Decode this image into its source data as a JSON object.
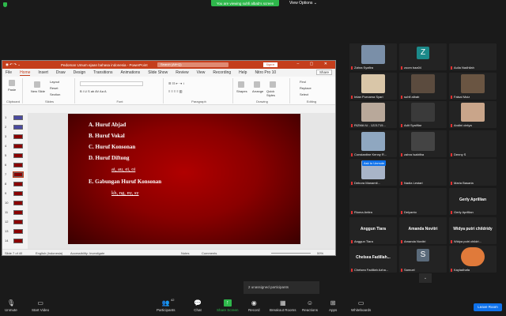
{
  "zoom": {
    "banner": "You are viewing suhfi albab's screen",
    "view_options": "View Options ⌄"
  },
  "ppt": {
    "title": "Pedoman Umum ejaan bahasa indonesia - PowerPoint",
    "search": "Search (Alt+Q)",
    "signin": "Sign in",
    "tabs": [
      "File",
      "Home",
      "Insert",
      "Draw",
      "Design",
      "Transitions",
      "Animations",
      "Slide Show",
      "Review",
      "View",
      "Recording",
      "Help",
      "Nitro Pro 10"
    ],
    "share": "Share",
    "ribbon": {
      "paste": "Paste",
      "clipboard": "Clipboard",
      "new_slide": "New Slide",
      "layout": "Layout",
      "reset": "Reset",
      "section": "Section",
      "slides": "Slides",
      "font": "Font",
      "paragraph": "Paragraph",
      "shapes": "Shapes",
      "arrange": "Arrange",
      "quick_styles": "Quick Styles",
      "drawing": "Drawing",
      "find": "Find",
      "replace": "Replace",
      "select": "Select",
      "editing": "Editing"
    },
    "thumbs": [
      "1",
      "2",
      "3",
      "4",
      "5",
      "6",
      "7",
      "8",
      "9",
      "10",
      "11",
      "12",
      "13",
      "14"
    ],
    "slide": {
      "lines": [
        "A.  Huruf Abjad",
        "B.  Huruf Vokal",
        "C.  Huruf Konsonan",
        "D.  Huruf Diftong"
      ],
      "diftong": "ai, au, ei, oi",
      "line_e": "E.  Gabungan Huruf Konsonan",
      "gabungan": "kh, ng, ny, sy"
    },
    "status": {
      "slide": "Slide 7 of 40",
      "lang": "English (Indonesia)",
      "access": "Accessibility: Investigate",
      "notes": "Notes",
      "comments": "Comments",
      "zoom": "59%"
    }
  },
  "participants": [
    {
      "name": "Zahra Syafira",
      "kind": "photo",
      "color": "#7a8fa8"
    },
    {
      "name": "zoom baa04",
      "kind": "letter",
      "letter": "Z",
      "color": "#1b8a8a"
    },
    {
      "name": "Aulia Nadhilah",
      "kind": "empty"
    },
    {
      "name": "Intan Purnama Syari",
      "kind": "photo",
      "color": "#d9c6a8"
    },
    {
      "name": "suhfi albab",
      "kind": "photo",
      "color": "#5b4b3e"
    },
    {
      "name": "Faisal Muiz",
      "kind": "photo",
      "color": "#6a5542"
    },
    {
      "name": "RIZMA IU - 1221715...",
      "kind": "photo",
      "color": "#b8a89a"
    },
    {
      "name": "Adit Syalifiar",
      "kind": "photo",
      "color": "#3a3a3a"
    },
    {
      "name": "Andini cintya",
      "kind": "photo",
      "color": "#c9a58a"
    },
    {
      "name": "Constantine Kenny R...",
      "kind": "photo",
      "color": "#8fa7c0"
    },
    {
      "name": "zahra Isabitha",
      "kind": "photo",
      "color": "#444"
    },
    {
      "name": "Denny S",
      "kind": "empty"
    },
    {
      "name": "Debora Manamti...",
      "kind": "photo",
      "color": "#a8b4c8"
    },
    {
      "name": "Nadia Lestari",
      "kind": "empty"
    },
    {
      "name": "Maria Basaria",
      "kind": "empty"
    },
    {
      "name": "Rioma Antira",
      "kind": "empty"
    },
    {
      "name": "Delyanto",
      "kind": "empty"
    },
    {
      "name": "Gerly Aprillian",
      "kind": "big"
    },
    {
      "name": "Anggun Tiara",
      "kind": "big"
    },
    {
      "name": "Amanda Novitri",
      "kind": "big"
    },
    {
      "name": "Widya putri childri...",
      "kind": "big"
    },
    {
      "name": "Chelsea Fadillah Azha...",
      "kind": "big"
    },
    {
      "name": "Samuel",
      "kind": "letter",
      "letter": "S",
      "color": "#5a6a7a"
    },
    {
      "name": "Kayladhafa",
      "kind": "photo",
      "color": "#e07a3a"
    }
  ],
  "participant_big": {
    "gerly": "Gerly Aprillian",
    "anggun": "Anggun Tiara",
    "amanda": "Amanda Novitri",
    "widya": "Widya putri childridy",
    "chelsea": "Chelsea Fadillah..."
  },
  "unmute": "Ask to Unmute",
  "unassigned": "2 unassigned participants",
  "toolbar": {
    "unmute": "Unmute",
    "video": "Start Video",
    "participants": "Participants",
    "participants_count": "42",
    "chat": "Chat",
    "share": "Share Screen",
    "record": "Record",
    "breakout": "Breakout Rooms",
    "reactions": "Reactions",
    "apps": "Apps",
    "whiteboards": "Whiteboards",
    "leave": "Leave Room"
  }
}
